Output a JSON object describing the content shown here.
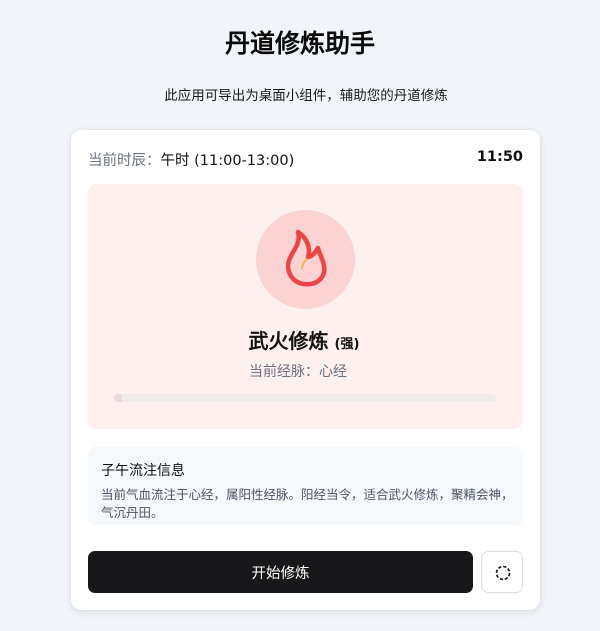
{
  "header": {
    "title": "丹道修炼助手",
    "subtitle": "此应用可导出为桌面小组件，辅助您的丹道修炼"
  },
  "time": {
    "label": "当前时辰：",
    "shichen": "午时 (11:00-13:00)",
    "clock": "11:50"
  },
  "practice": {
    "icon": "flame-icon",
    "mode": "武火修炼",
    "strength": "(强)",
    "meridian": "当前经脉：心经",
    "progress": 0.02,
    "colors": {
      "flame": "#ef4444",
      "circle": "#fbd3d3",
      "panel": "#fff0f0"
    }
  },
  "info": {
    "title": "子午流注信息",
    "text": "当前气血流注于心经，属阳性经脉。阳经当令，适合武火修炼，聚精会神，气沉丹田。"
  },
  "actions": {
    "start_label": "开始修炼",
    "reset_icon": "reset-icon"
  }
}
